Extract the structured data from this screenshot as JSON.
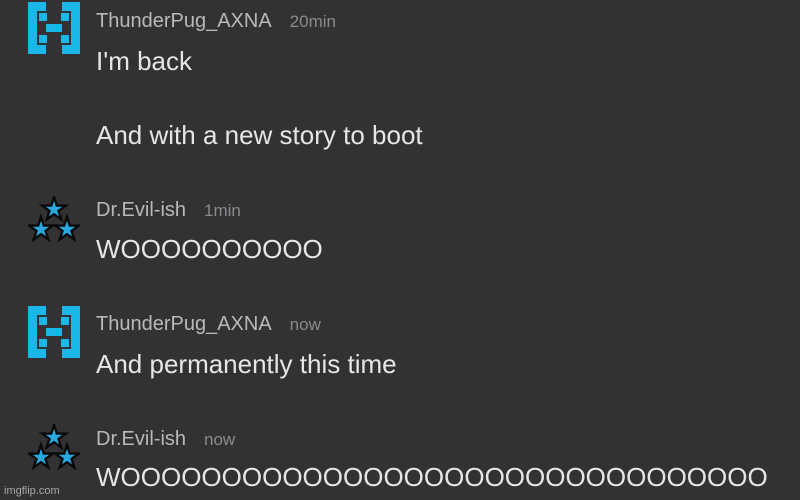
{
  "messages": [
    {
      "username": "ThunderPug_AXNA",
      "time": "20min",
      "avatar_icon": "blue-bracket-logo-icon",
      "lines": [
        "I'm back",
        "And with a new story to boot"
      ]
    },
    {
      "username": "Dr.Evil-ish",
      "time": "1min",
      "avatar_icon": "three-stars-icon",
      "lines": [
        "WOOOOOOOOOO"
      ]
    },
    {
      "username": "ThunderPug_AXNA",
      "time": "now",
      "avatar_icon": "blue-bracket-logo-icon",
      "lines": [
        "And permanently this time"
      ]
    },
    {
      "username": "Dr.Evil-ish",
      "time": "now",
      "avatar_icon": "three-stars-icon",
      "lines": [
        "WOOOOOOOOOOOOOOOOOOOOOOOOOOOOOOOO"
      ]
    }
  ],
  "watermark": "imgflip.com",
  "colors": {
    "background": "#323234",
    "logo_blue": "#1ab7ea",
    "star_blue": "#29a9e0"
  }
}
